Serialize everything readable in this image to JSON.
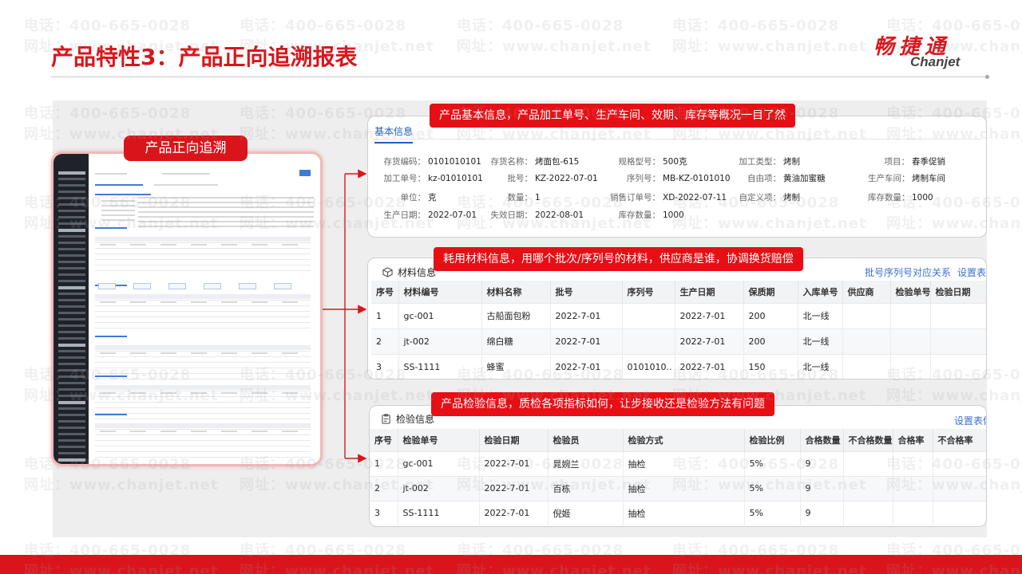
{
  "title": "产品特性3：产品正向追溯报表",
  "logo": {
    "cn": "畅捷通",
    "en": "Chanjet"
  },
  "watermark": {
    "phone": "电话：400-665-0028",
    "web": "网址：www.chanjet.net"
  },
  "thumbnail_label": "产品正向追溯",
  "callouts": {
    "basic": "产品基本信息，产品加工单号、生产车间、效期、库存等概况一目了然",
    "materials": "耗用材料信息，用哪个批次/序列号的材料，供应商是谁，协调换货赔偿",
    "inspection": "产品检验信息，质检各项指标如何，让步接收还是检验方法有问题"
  },
  "basic_info": {
    "tab": "基本信息",
    "rows": [
      [
        {
          "label": "存货编码：",
          "value": "0101010101"
        },
        {
          "label": "存货名称：",
          "value": "烤面包-615"
        },
        {
          "label": "规格型号：",
          "value": "500克"
        },
        {
          "label": "加工类型：",
          "value": "烤制"
        },
        {
          "label": "项目：",
          "value": "春季促销"
        }
      ],
      [
        {
          "label": "加工单号：",
          "value": "kz-01010101"
        },
        {
          "label": "批号：",
          "value": "KZ-2022-07-01"
        },
        {
          "label": "序列号：",
          "value": "MB-KZ-0101010"
        },
        {
          "label": "自由项：",
          "value": "黄油加蜜糖"
        },
        {
          "label": "生产车间：",
          "value": "烤制车间"
        }
      ],
      [
        {
          "label": "单位：",
          "value": "克"
        },
        {
          "label": "数量：",
          "value": "1"
        },
        {
          "label": "销售订单号：",
          "value": "XD-2022-07-11"
        },
        {
          "label": "自定义项：",
          "value": "烤制"
        },
        {
          "label": "库存数量：",
          "value": "1000"
        }
      ],
      [
        {
          "label": "生产日期：",
          "value": "2022-07-01"
        },
        {
          "label": "失效日期：",
          "value": "2022-08-01"
        },
        {
          "label": "库存数量：",
          "value": "1000"
        }
      ]
    ]
  },
  "materials": {
    "title": "材料信息",
    "link_relation": "批号序列号对应关系",
    "link_settings": "设置表体",
    "columns": [
      "序号",
      "材料编号",
      "材料名称",
      "批号",
      "序列号",
      "生产日期",
      "保质期",
      "入库单号",
      "供应商",
      "检验单号",
      "检验日期"
    ],
    "rows": [
      [
        "1",
        "gc-001",
        "古船面包粉",
        "2022-7-01",
        "",
        "2022-7-01",
        "200",
        "北一线",
        "",
        "",
        ""
      ],
      [
        "2",
        "jt-002",
        "绵白糖",
        "2022-7-01",
        "",
        "2022-7-01",
        "200",
        "北一线",
        "",
        "",
        ""
      ],
      [
        "3",
        "SS-1111",
        "蜂蜜",
        "2022-7-01",
        "0101010..",
        "2022-7-01",
        "150",
        "北一线",
        "",
        "",
        ""
      ]
    ]
  },
  "inspection": {
    "title": "检验信息",
    "link_settings": "设置表体",
    "columns": [
      "序号",
      "检验单号",
      "检验日期",
      "检验员",
      "检验方式",
      "检验比例",
      "合格数量",
      "不合格数量",
      "合格率",
      "不合格率"
    ],
    "rows": [
      [
        "1",
        "gc-001",
        "2022-7-01",
        "晁婉兰",
        "抽检",
        "5%",
        "9",
        "",
        "",
        ""
      ],
      [
        "2",
        "jt-002",
        "2022-7-01",
        "百栋",
        "抽检",
        "5%",
        "9",
        "",
        "",
        ""
      ],
      [
        "3",
        "SS-1111",
        "2022-7-01",
        "倪姬",
        "抽检",
        "5%",
        "9",
        "",
        "",
        ""
      ]
    ]
  },
  "colors": {
    "brand_red": "#d9151b",
    "callout_red": "#e60f15",
    "link_blue": "#3d6fd0"
  },
  "icons": {
    "materials": "box-icon",
    "inspection": "clipboard-icon"
  }
}
